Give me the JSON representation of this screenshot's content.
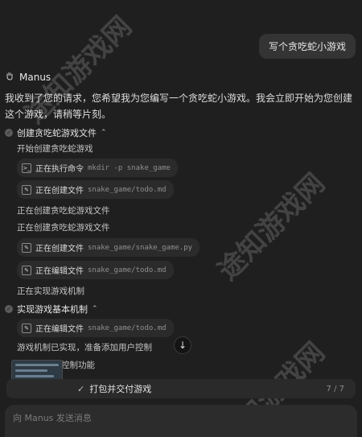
{
  "user_message": "写个贪吃蛇小游戏",
  "agent": {
    "name": "Manus",
    "icon": "hand-icon"
  },
  "intro_text": "我收到了您的请求，您希望我为您编写一个贪吃蛇小游戏。我会立即开始为您创建这个游戏，请稍等片刻。",
  "steps": [
    {
      "title": "创建贪吃蛇游戏文件",
      "subtext": "开始创建贪吃蛇游戏",
      "actions": [
        {
          "icon": "terminal-icon",
          "label": "正在执行命令",
          "detail": "mkdir -p snake_game"
        },
        {
          "icon": "edit-file-icon",
          "label": "正在创建文件",
          "detail": "snake_game/todo.md"
        }
      ],
      "notes": [
        "正在创建贪吃蛇游戏文件",
        "正在创建贪吃蛇游戏文件"
      ],
      "actions2": [
        {
          "icon": "edit-file-icon",
          "label": "正在创建文件",
          "detail": "snake_game/snake_game.py"
        },
        {
          "icon": "edit-file-icon",
          "label": "正在编辑文件",
          "detail": "snake_game/todo.md"
        }
      ],
      "tail_note": "正在实现游戏机制"
    },
    {
      "title": "实现游戏基本机制",
      "actions": [
        {
          "icon": "edit-file-icon",
          "label": "正在编辑文件",
          "detail": "snake_game/todo.md"
        }
      ],
      "note": "游戏机制已实现，准备添加用户控制",
      "partial_note": "控制功能"
    }
  ],
  "progress": {
    "task": "打包并交付游戏",
    "count": "7 / 7"
  },
  "composer": {
    "placeholder": "向 Manus 发送消息"
  },
  "watermarks": [
    "途知游戏网",
    "途知游戏网",
    "途知游戏网"
  ]
}
